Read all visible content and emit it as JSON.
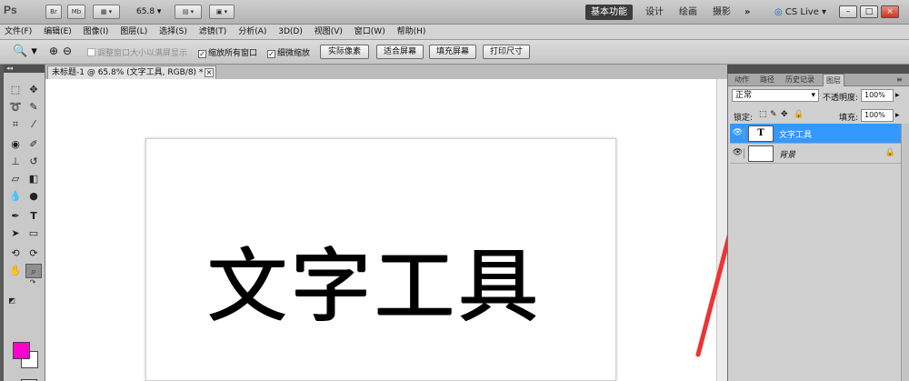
{
  "app": {
    "logo": "Ps",
    "zoom": "65.8",
    "mini_buttons": [
      "Br",
      "Mb"
    ],
    "workspaces": [
      "基本功能",
      "设计",
      "绘画",
      "摄影",
      "»"
    ],
    "active_workspace": "基本功能",
    "cs_live": "CS Live",
    "window_controls": [
      "–",
      "□",
      "×"
    ]
  },
  "menu": [
    "文件(F)",
    "编辑(E)",
    "图像(I)",
    "图层(L)",
    "选择(S)",
    "滤镜(T)",
    "分析(A)",
    "3D(D)",
    "视图(V)",
    "窗口(W)",
    "帮助(H)"
  ],
  "options": {
    "resize_windows": "调整窗口大小以满屏显示",
    "zoom_all": "缩放所有窗口",
    "scrubby_zoom": "细微缩放",
    "buttons": [
      "实际像素",
      "适合屏幕",
      "填充屏幕",
      "打印尺寸"
    ]
  },
  "document": {
    "tab_title": "未标题-1 @ 65.8% (文字工具, RGB/8) *",
    "close": "×",
    "canvas_text": "文字工具"
  },
  "toolbox": {
    "colors": {
      "foreground": "#ff00cc",
      "background": "#ffffff"
    }
  },
  "panel": {
    "tabs": [
      "动作",
      "路径",
      "历史记录",
      "图层"
    ],
    "active_tab": "图层",
    "blend_mode": "正常",
    "opacity_label": "不透明度:",
    "opacity_value": "100%",
    "lock_label": "锁定:",
    "fill_label": "填充:",
    "fill_value": "100%",
    "layers": [
      {
        "name": "文字工具",
        "thumb": "T",
        "active": true
      },
      {
        "name": "背景",
        "thumb": "",
        "active": false,
        "locked": true
      }
    ]
  }
}
